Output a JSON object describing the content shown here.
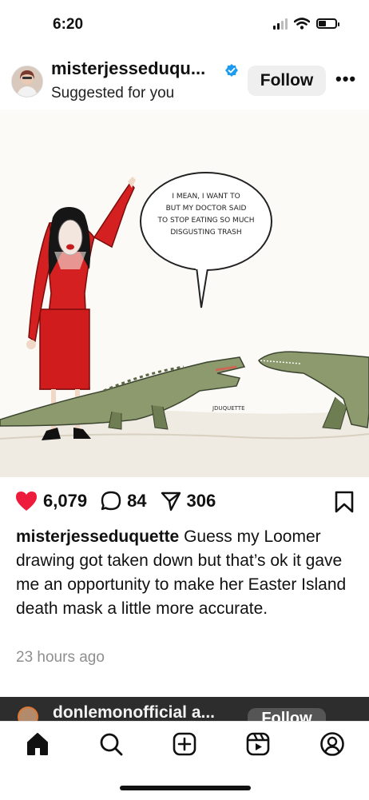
{
  "status_bar": {
    "time": "6:20"
  },
  "post": {
    "username": "misterjesseduqu...",
    "subtitle": "Suggested for you",
    "follow_label": "Follow",
    "image": {
      "speech_bubble_lines": [
        "I MEAN, I WANT TO",
        "BUT MY DOCTOR SAID",
        "TO STOP EATING SO MUCH",
        "DISGUSTING TRASH"
      ],
      "signature": "JDUQUETTE"
    },
    "likes": "6,079",
    "comments": "84",
    "shares": "306",
    "caption_user": "misterjesseduquette",
    "caption_text": " Guess my Loomer drawing got taken down but that’s ok it gave me an opportunity to make her Easter Island death mask a little more accurate.",
    "timestamp": "23 hours ago"
  },
  "next_post": {
    "username": "donlemonofficial a...",
    "follow_label": "Follow"
  },
  "colors": {
    "like_red": "#ed1c3c",
    "verified_blue": "#1d9bf0"
  },
  "icons": [
    "home-icon",
    "search-icon",
    "create-icon",
    "reels-icon",
    "profile-icon"
  ]
}
